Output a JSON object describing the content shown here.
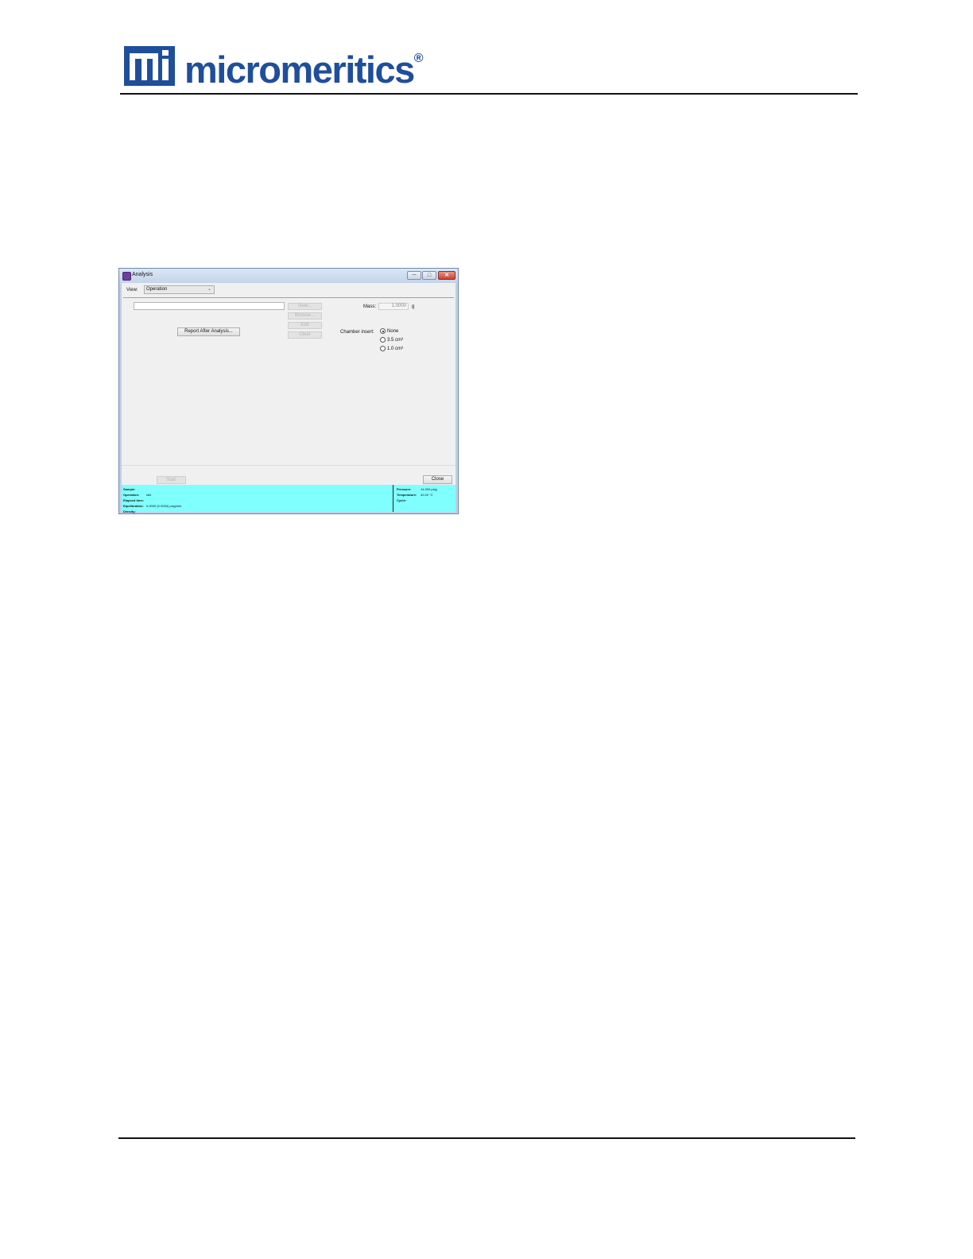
{
  "page": {
    "brand": "micromeritics",
    "brand_reg": "®"
  },
  "window": {
    "title": "Analysis",
    "controls": {
      "minimize": "─",
      "maximize": "□",
      "close": "✕"
    },
    "view_label": "View:",
    "view_value": "Operation",
    "buttons": {
      "new": "New...",
      "browse": "Browse...",
      "edit": "Edit",
      "clear": "Clear",
      "report_after_analysis": "Report After Analysis...",
      "start": "Start",
      "close": "Close"
    },
    "mass": {
      "label": "Mass:",
      "value": "1.0000",
      "unit": "g"
    },
    "chamber_insert": {
      "label": "Chamber insert:",
      "options": [
        "None",
        "3.5 cm³",
        "1.0 cm³"
      ],
      "selected": "None"
    },
    "status": {
      "left": [
        {
          "key": "Sample:",
          "value": ""
        },
        {
          "key": "Operation:",
          "value": "Idle"
        },
        {
          "key": "Elapsed time:",
          "value": ""
        },
        {
          "key": "Equilibration:",
          "value": "0.0000 (0.0050) psig/min"
        },
        {
          "key": "Density:",
          "value": ""
        }
      ],
      "right": [
        {
          "key": "Pressure:",
          "value": "14.900 psig"
        },
        {
          "key": "Temperature:",
          "value": "32.00 °C"
        },
        {
          "key": "Cycle:",
          "value": ""
        }
      ]
    }
  }
}
